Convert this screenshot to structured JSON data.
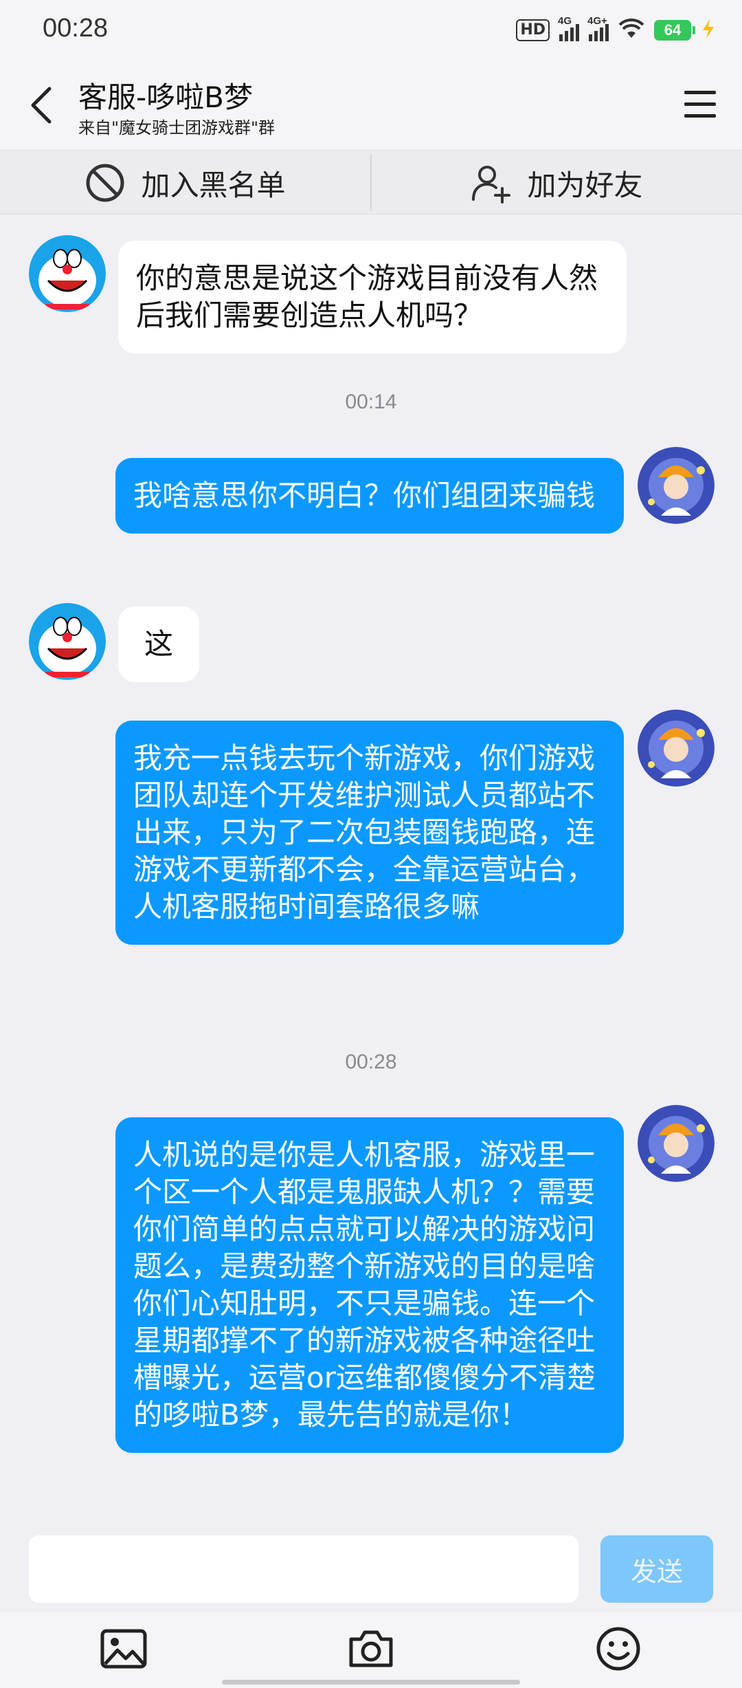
{
  "status_bar": {
    "time": "00:28",
    "hd_label": "HD",
    "signal1_label": "4G",
    "signal2_label": "4G+",
    "battery": "64"
  },
  "header": {
    "title": "客服-哆啦B梦",
    "subtitle": "来自\"魔女骑士团游戏群\"群"
  },
  "actions": {
    "block_label": "加入黑名单",
    "add_friend_label": "加为好友"
  },
  "messages": [
    {
      "side": "left",
      "text": "你的意思是说这个游戏目前没有人然后我们需要创造点人机吗？"
    },
    {
      "type": "time",
      "text": "00:14"
    },
    {
      "side": "right",
      "text": "我啥意思你不明白？你们组团来骗钱"
    },
    {
      "side": "left",
      "text": "这"
    },
    {
      "side": "right",
      "text": "我充一点钱去玩个新游戏，你们游戏团队却连个开发维护测试人员都站不出来，只为了二次包装圈钱跑路，连游戏不更新都不会，全靠运营站台，人机客服拖时间套路很多嘛"
    },
    {
      "type": "time",
      "text": "00:28"
    },
    {
      "side": "right",
      "text": "人机说的是你是人机客服，游戏里一个区一个人都是鬼服缺人机？？需要你们简单的点点就可以解决的游戏问题么，是费劲整个新游戏的目的是啥你们心知肚明，不只是骗钱。连一个星期都撑不了的新游戏被各种途径吐槽曝光，运营or运维都傻傻分不清楚的哆啦B梦，最先告的就是你！"
    }
  ],
  "input": {
    "placeholder": "",
    "send_label": "发送"
  },
  "bottom_icons": [
    "image-icon",
    "camera-icon",
    "emoji-icon"
  ]
}
